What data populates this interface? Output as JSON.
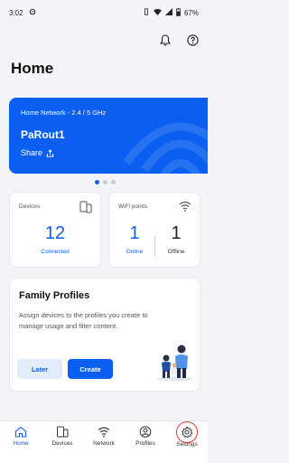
{
  "status_bar": {
    "time": "3:02",
    "battery": "67%"
  },
  "page": {
    "title": "Home"
  },
  "network": {
    "subtitle": "Home Network - 2.4 / 5 GHz",
    "name": "PaRout1",
    "share_label": "Share"
  },
  "carousel": {
    "pages": 3,
    "active": 0
  },
  "devices": {
    "label": "Devices",
    "count": "12",
    "count_label": "Connected"
  },
  "wifi_points": {
    "label": "WiFi points",
    "online": "1",
    "online_label": "Online",
    "offline": "1",
    "offline_label": "Offline"
  },
  "family": {
    "title": "Family Profiles",
    "description": "Assign devices to the profiles you create to manage usage and filter content.",
    "later_label": "Later",
    "create_label": "Create"
  },
  "nav": {
    "home": "Home",
    "devices": "Devices",
    "network": "Network",
    "profiles": "Profiles",
    "settings": "Settings"
  },
  "colors": {
    "accent": "#0a5ff0",
    "highlight": "#e53935"
  }
}
